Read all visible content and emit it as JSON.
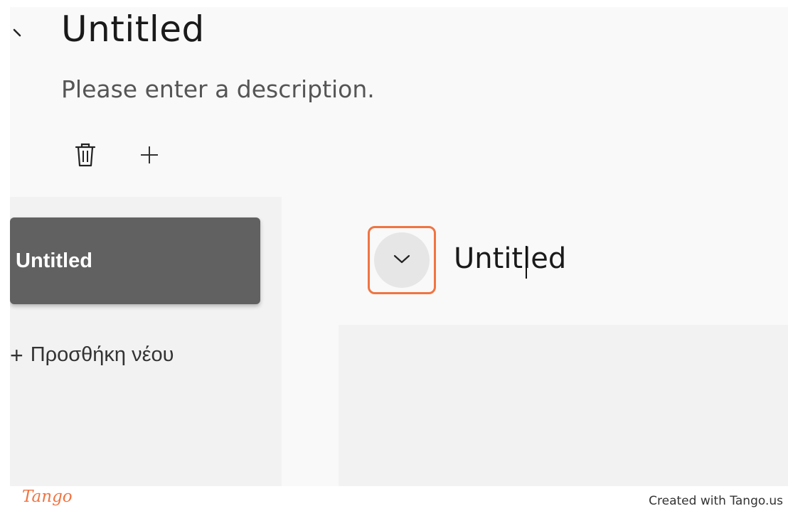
{
  "page": {
    "title": "Untitled",
    "description": "Please enter a description."
  },
  "toolbar": {
    "delete_icon": "trash-icon",
    "add_icon": "plus-icon"
  },
  "sidebar": {
    "items": [
      {
        "label": "Untitled",
        "selected": true
      }
    ],
    "add_new_label": "Προσθήκη νέου"
  },
  "section": {
    "toggle_icon": "chevron-down-icon",
    "title_value": "Untitled"
  },
  "footer": {
    "logo_text": "Tango",
    "credit": "Created with Tango.us"
  },
  "colors": {
    "highlight": "#f07442",
    "selected_item_bg": "#616161",
    "panel_bg": "#f2f2f2",
    "app_bg": "#f9f9f9"
  }
}
